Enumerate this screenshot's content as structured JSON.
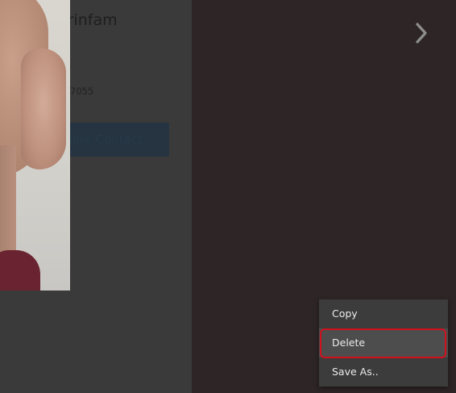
{
  "contact": {
    "name_fragment": "arinfam",
    "phone_fragment": "7055",
    "share_label": "hare Contact"
  },
  "viewer": {
    "next_icon": "chevron-right-icon"
  },
  "context_menu": {
    "items": [
      {
        "label": "Copy"
      },
      {
        "label": "Delete"
      },
      {
        "label": "Save As.."
      }
    ],
    "highlighted_item": "Delete"
  },
  "colors": {
    "viewer_background": "#2e2626",
    "panel_background": "#3a3a3a",
    "menu_background": "#3c3c3c",
    "menu_highlight": "#4d4d4d",
    "highlight_ring": "#d0101c"
  }
}
